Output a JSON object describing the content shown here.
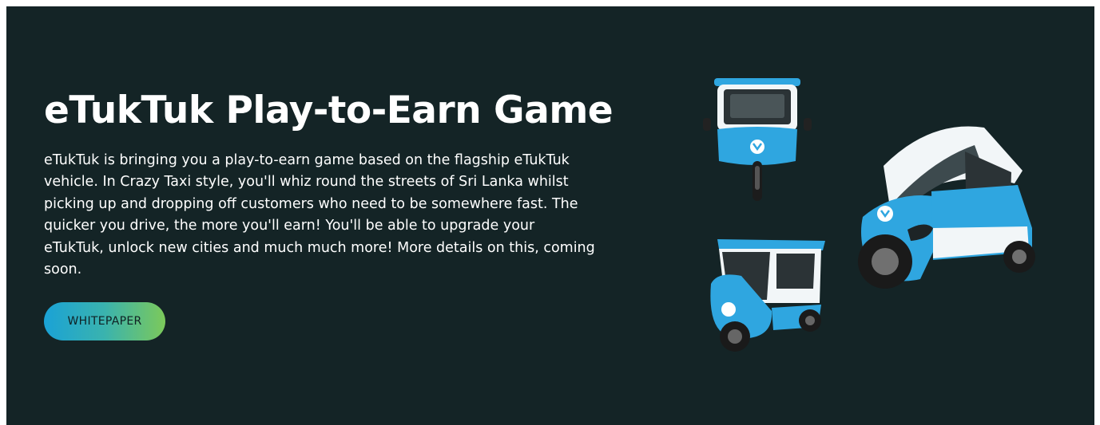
{
  "hero": {
    "title": "eTukTuk Play-to-Earn Game",
    "description": "eTukTuk is bringing you a play-to-earn game based on the flagship eTukTuk vehicle. In Crazy Taxi style, you'll whiz round the streets of Sri Lanka whilst picking up and dropping off customers who need to be somewhere fast. The quicker you drive, the more you'll earn! You'll be able to upgrade your eTukTuk, unlock new cities and much much more! More details on this, coming soon.",
    "button_label": "WHITEPAPER"
  },
  "colors": {
    "background": "#142426",
    "vehicle_blue": "#2fa6e0",
    "vehicle_white": "#f2f6f8",
    "button_gradient_start": "#1aa2d6",
    "button_gradient_end": "#7cc95a"
  },
  "icons": [
    "etuktuk-front-view-icon",
    "etuktuk-side-view-icon",
    "etuktuk-three-quarter-view-icon"
  ]
}
